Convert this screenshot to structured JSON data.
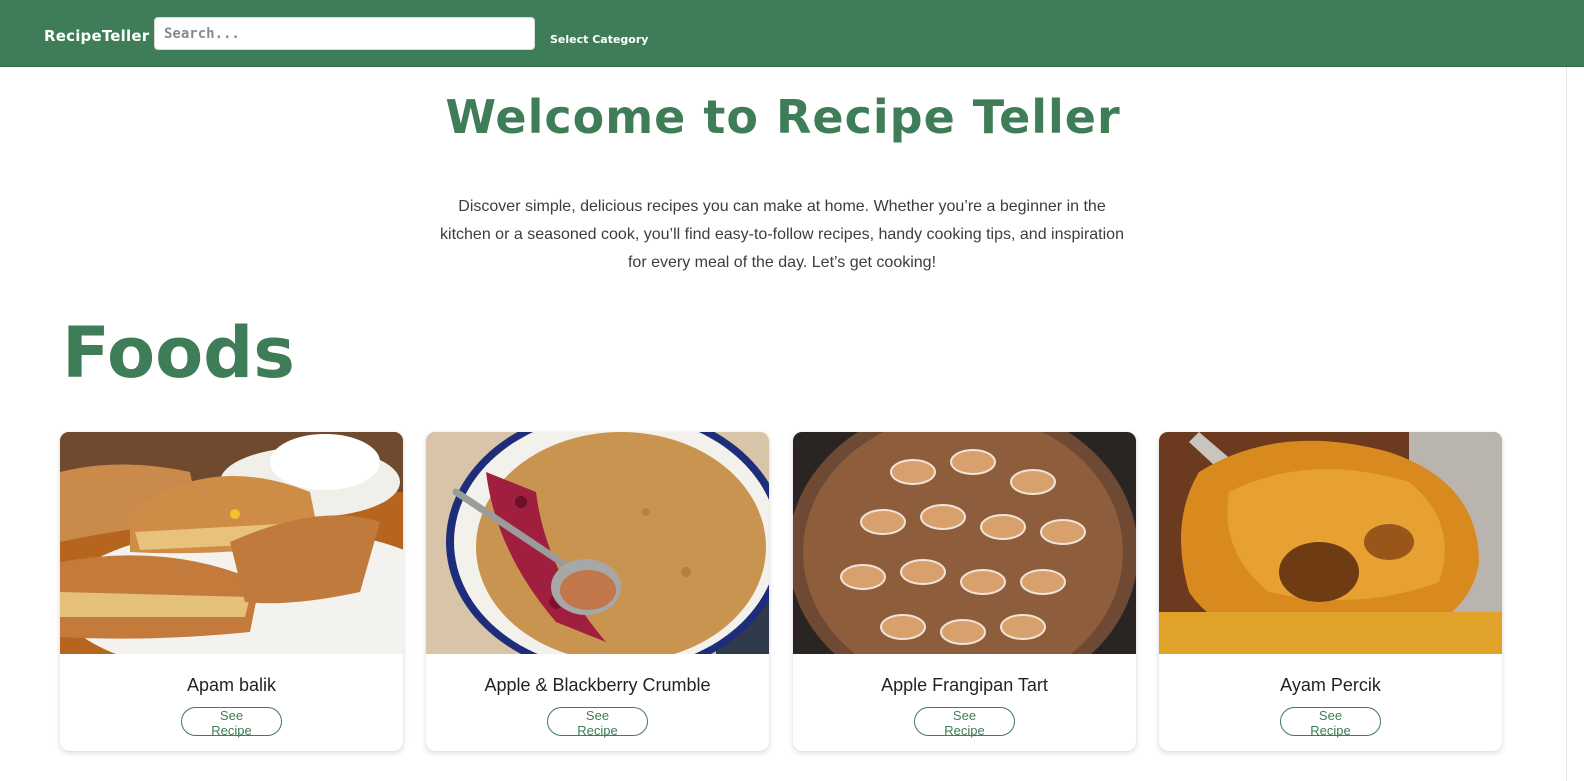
{
  "navbar": {
    "brand": "RecipeTeller",
    "search_placeholder": "Search...",
    "category_label": "Select Category",
    "background": "#3f7d58"
  },
  "hero": {
    "title": "Welcome to Recipe Teller",
    "description": "Discover simple, delicious recipes you can make at home. Whether you’re a beginner in the kitchen or a seasoned cook, you’ll find easy-to-follow recipes, handy cooking tips, and inspiration for every meal of the day. Let’s get cooking!"
  },
  "section": {
    "title": "Foods"
  },
  "cards": [
    {
      "title": "Apam balik",
      "button": "See Recipe",
      "image": "apam-balik-photo"
    },
    {
      "title": "Apple & Blackberry Crumble",
      "button": "See Recipe",
      "image": "crumble-photo"
    },
    {
      "title": "Apple Frangipan Tart",
      "button": "See Recipe",
      "image": "tart-photo"
    },
    {
      "title": "Ayam Percik",
      "button": "See Recipe",
      "image": "ayam-percik-photo"
    }
  ],
  "colors": {
    "accent": "#3f7d58",
    "text": "#1f2328"
  }
}
